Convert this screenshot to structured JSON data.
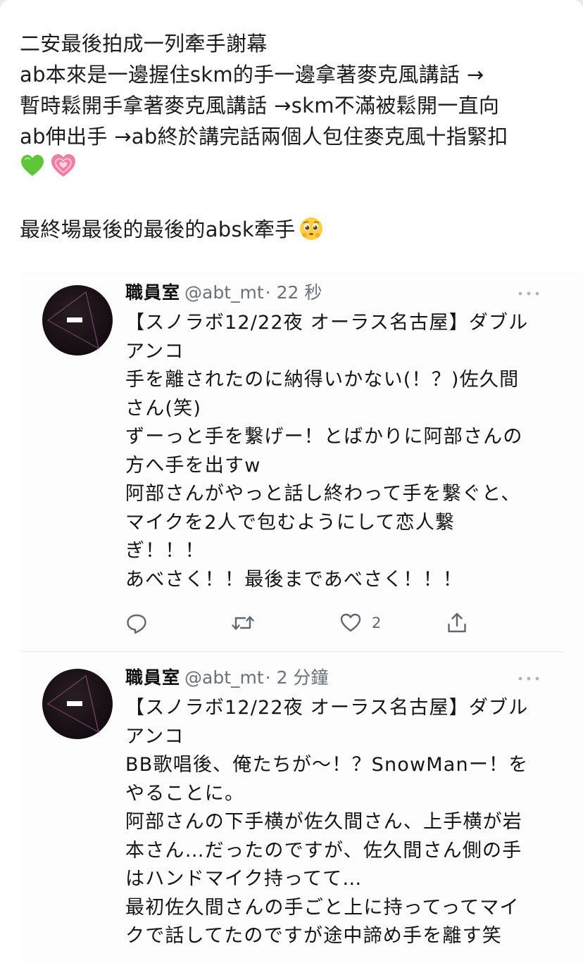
{
  "post": {
    "lines": [
      "二安最後拍成一列牽手謝幕",
      " ab本來是一邊握住skm的手一邊拿著麥克風講話 →",
      "暫時鬆開手拿著麥克風講話 →skm不滿被鬆開一直向",
      "ab伸出手 →ab終於講完話兩個人包住麥克風十指緊扣"
    ],
    "emojis": [
      "green-heart",
      "growing-heart"
    ],
    "closing": "最終場最後的最後的absk牽手",
    "closing_emoji": "pleading-face"
  },
  "tweets": [
    {
      "name": "職員室",
      "handle": "@abt_mt",
      "time": "· 22 秒",
      "lines": [
        "【スノラボ12/22夜 オーラス名古屋】ダブル",
        "アンコ",
        "手を離されたのに納得いかない(！？)佐久間",
        "さん(笑)",
        "ずーっと手を繋げー！とばかりに阿部さんの",
        "方へ手を出すw",
        "阿部さんがやっと話し終わって手を繋ぐと、",
        "マイクを2人で包むようにして恋人繋",
        "ぎ！！！",
        "あべさく！！最後まであべさく！！！"
      ],
      "like_count": "2"
    },
    {
      "name": "職員室",
      "handle": "@abt_mt",
      "time": "· 2 分鐘",
      "lines": [
        "【スノラボ12/22夜 オーラス名古屋】ダブル",
        "アンコ",
        "BB歌唱後、俺たちが～！？SnowManー！を",
        "やることに。",
        "阿部さんの下手横が佐久間さん、上手横が岩",
        "本さん…だったのですが、佐久間さん側の手",
        "はハンドマイク持ってて…",
        "最初佐久間さんの手ごと上に持ってってマイ",
        "クで話してたのですが途中諦め手を離す笑"
      ]
    }
  ],
  "icons": {
    "reply": "reply-icon",
    "retweet": "retweet-icon",
    "like": "heart-icon",
    "share": "share-icon",
    "more": "more-icon"
  },
  "colors": {
    "meta_gray": "#6b7178",
    "green_heart": "#5fc63c",
    "pink_heart": "#f27ea6"
  }
}
